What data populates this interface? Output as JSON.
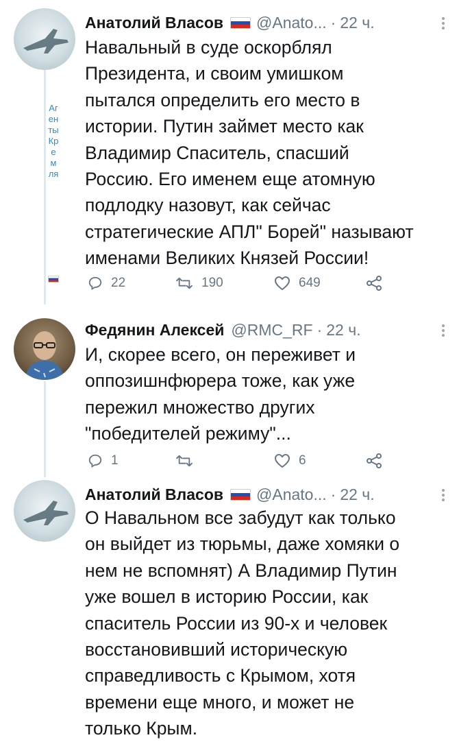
{
  "tweets": [
    {
      "name": "Анатолий Власов",
      "handle": "@Anato...",
      "dot": "·",
      "time": "22 ч.",
      "text": "Навальный в суде оскорблял\nПрезидента, и своим умишком\nпытался определить его место в\nистории. Путин займет место как\nВладимир Спаситель, спасший\nРоссию. Его именем еще атомную\nподлодку назовут, как сейчас\nстратегические АПЛ\" Борей\" называют\nименами Великих Князей России!",
      "replies": "22",
      "retweets": "190",
      "likes": "649",
      "side_label": "Агенты Кремля"
    },
    {
      "name": "Федянин Алексей",
      "handle": "@RMC_RF",
      "dot": "·",
      "time": "22 ч.",
      "text": "И, скорее всего, он переживет и\nоппозишнфюрера тоже, как уже\nпережил множество других\n\"победителей режиму\"...",
      "replies": "1",
      "retweets": "",
      "likes": "6"
    },
    {
      "name": "Анатолий Власов",
      "handle": "@Anato...",
      "dot": "·",
      "time": "22 ч.",
      "text": "О Навальном все забудут как только\nон выйдет из тюрьмы, даже хомяки о\nнем не вспомнят) А Владимир Путин\nуже вошел в историю России, как\nспаситель России из 90-х и человек\nвосстановивший историческую\nсправедливость с Крымом, хотя\nвремени еще много, и может не\nтолько Крым."
    }
  ],
  "colors": {
    "text": "#14171a",
    "secondary": "#657786",
    "thread_line": "#e1e8ed",
    "side_label": "#2e8bc9"
  }
}
